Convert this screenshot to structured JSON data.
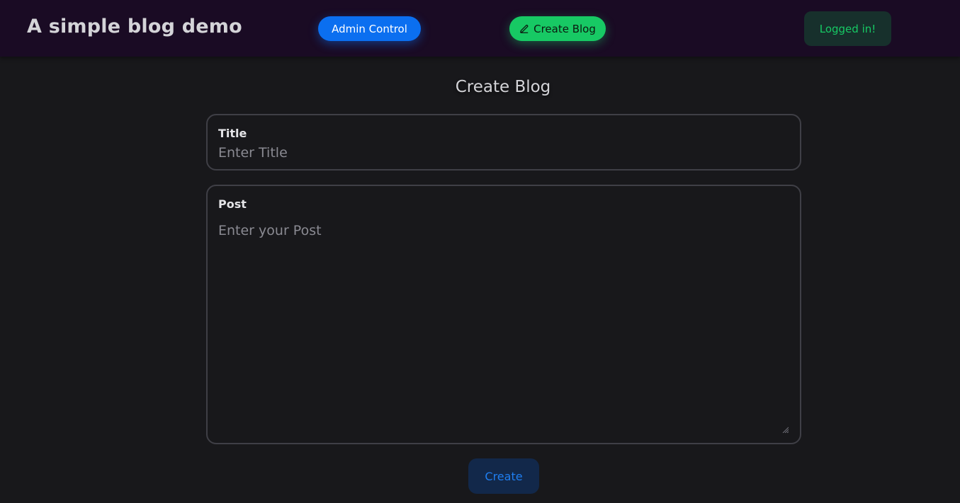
{
  "header": {
    "brand": "A simple blog demo",
    "admin_button": "Admin Control",
    "create_blog_button": "Create Blog",
    "create_blog_icon": "pencil-icon",
    "status": "Logged in!"
  },
  "form": {
    "heading": "Create Blog",
    "title_label": "Title",
    "title_value": "",
    "title_placeholder": "Enter Title",
    "post_label": "Post",
    "post_value": "",
    "post_placeholder": "Enter your Post",
    "submit_label": "Create"
  },
  "colors": {
    "primary": "#0b6ff0",
    "success": "#17c964",
    "background": "#18181b",
    "navbar": "#1a0b24"
  }
}
